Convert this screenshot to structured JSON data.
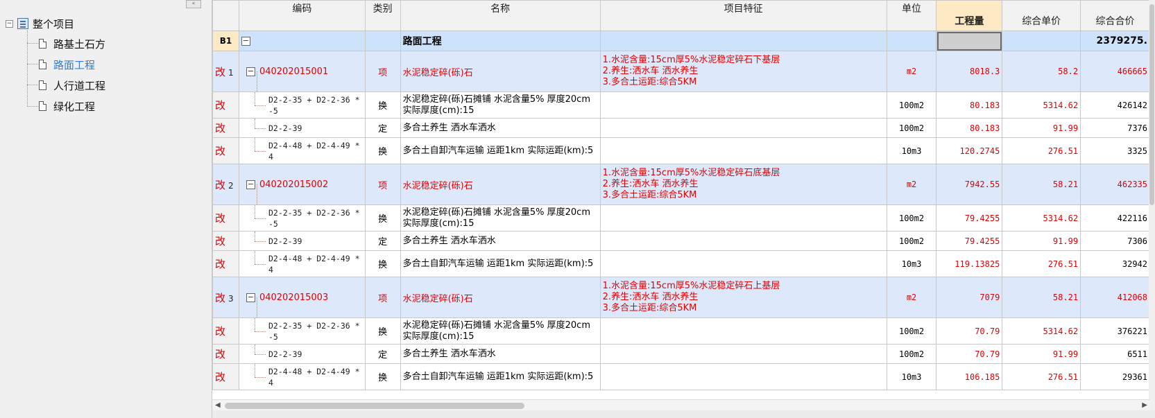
{
  "tree": {
    "collapse_glyph": "«",
    "root_toggle": "⊟",
    "root_label": "整个项目",
    "children": [
      {
        "label": "路基土石方"
      },
      {
        "label": "路面工程"
      },
      {
        "label": "人行道工程"
      },
      {
        "label": "绿化工程"
      }
    ]
  },
  "columns": {
    "code": "编码",
    "type": "类别",
    "name": "名称",
    "features": "项目特征",
    "unit": "单位",
    "qty": "工程量",
    "unit_price": "综合单价",
    "total": "综合合价"
  },
  "section": {
    "label": "B1",
    "toggle": "−",
    "name": "路面工程",
    "total": "2379275."
  },
  "items": [
    {
      "mark": "改",
      "num": "1",
      "toggle": "−",
      "code": "040202015001",
      "type": "项",
      "name": "水泥稳定碎(砾)石",
      "features": [
        "1.水泥含量:15cm厚5%水泥稳定碎石下基层",
        "2.养生:洒水车 洒水养生",
        "3.多合土运距:综合5KM"
      ],
      "unit": "m2",
      "qty": "8018.3",
      "price": "58.2",
      "total": "466665",
      "subs": [
        {
          "mark": "改",
          "code": "D2-2-35 + D2-2-36 * -5",
          "type": "换",
          "name": "水泥稳定碎(砾)石摊铺 水泥含量5% 厚度20cm  实际厚度(cm):15",
          "unit": "100m2",
          "qty": "80.183",
          "price": "5314.62",
          "total": "426142"
        },
        {
          "mark": "改",
          "code": "D2-2-39",
          "type": "定",
          "name": "多合土养生 洒水车洒水",
          "unit": "100m2",
          "qty": "80.183",
          "price": "91.99",
          "total": "7376"
        },
        {
          "mark": "改",
          "code": "D2-4-48 + D2-4-49 * 4",
          "type": "换",
          "name": "多合土自卸汽车运输 运距1km  实际运距(km):5",
          "unit": "10m3",
          "qty": "120.2745",
          "price": "276.51",
          "total": "3325"
        }
      ]
    },
    {
      "mark": "改",
      "num": "2",
      "toggle": "−",
      "code": "040202015002",
      "type": "项",
      "name": "水泥稳定碎(砾)石",
      "features": [
        "1.水泥含量:15cm厚5%水泥稳定碎石底基层",
        "2.养生:洒水车 洒水养生",
        "3.多合土运距:综合5KM"
      ],
      "unit": "m2",
      "qty": "7942.55",
      "price": "58.21",
      "total": "462335",
      "subs": [
        {
          "mark": "改",
          "code": "D2-2-35 + D2-2-36 * -5",
          "type": "换",
          "name": "水泥稳定碎(砾)石摊铺 水泥含量5% 厚度20cm  实际厚度(cm):15",
          "unit": "100m2",
          "qty": "79.4255",
          "price": "5314.62",
          "total": "422116"
        },
        {
          "mark": "改",
          "code": "D2-2-39",
          "type": "定",
          "name": "多合土养生 洒水车洒水",
          "unit": "100m2",
          "qty": "79.4255",
          "price": "91.99",
          "total": "7306"
        },
        {
          "mark": "改",
          "code": "D2-4-48 + D2-4-49 * 4",
          "type": "换",
          "name": "多合土自卸汽车运输 运距1km  实际运距(km):5",
          "unit": "10m3",
          "qty": "119.13825",
          "price": "276.51",
          "total": "32942"
        }
      ]
    },
    {
      "mark": "改",
      "num": "3",
      "toggle": "−",
      "code": "040202015003",
      "type": "项",
      "name": "水泥稳定碎(砾)石",
      "features": [
        "1.水泥含量:15cm厚5%水泥稳定碎石上基层",
        "2.养生:洒水车 洒水养生",
        "3.多合土运距:综合5KM"
      ],
      "unit": "m2",
      "qty": "7079",
      "price": "58.21",
      "total": "412068",
      "subs": [
        {
          "mark": "改",
          "code": "D2-2-35 + D2-2-36 * -5",
          "type": "换",
          "name": "水泥稳定碎(砾)石摊铺 水泥含量5% 厚度20cm  实际厚度(cm):15",
          "unit": "100m2",
          "qty": "70.79",
          "price": "5314.62",
          "total": "376221"
        },
        {
          "mark": "改",
          "code": "D2-2-39",
          "type": "定",
          "name": "多合土养生 洒水车洒水",
          "unit": "100m2",
          "qty": "70.79",
          "price": "91.99",
          "total": "6511"
        },
        {
          "mark": "改",
          "code": "D2-4-48 + D2-4-49 * 4",
          "type": "换",
          "name": "多合土自卸汽车运输 运距1km  实际运距(km):5",
          "unit": "10m3",
          "qty": "106.185",
          "price": "276.51",
          "total": "29361"
        }
      ]
    }
  ],
  "scroll": {
    "left_arrow": "◀",
    "right_arrow": "▶"
  }
}
